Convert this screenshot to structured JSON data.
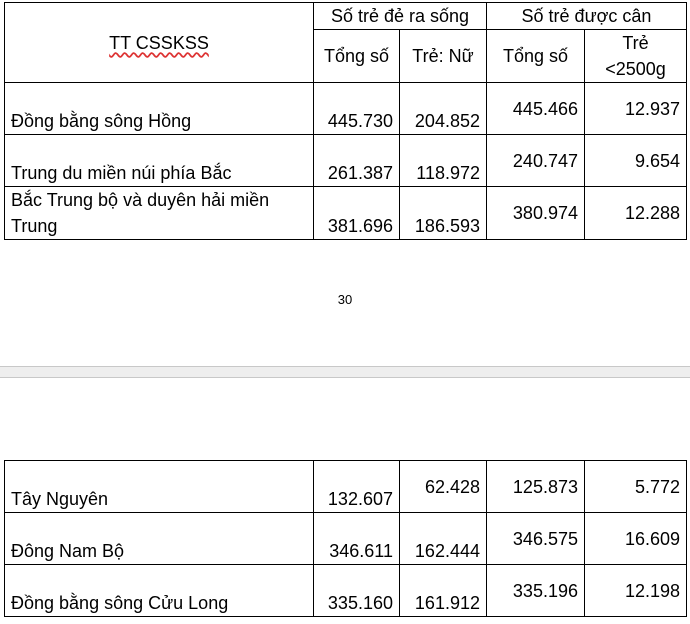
{
  "header": {
    "region_col": "TT CSSKSS",
    "group_live": "Số trẻ đẻ ra sống",
    "group_weighed": "Số trẻ được cân",
    "live_total": "Tổng số",
    "live_female": "Trẻ: Nữ",
    "weighed_total": "Tổng số",
    "weighed_low": "Trẻ <2500g"
  },
  "rows_top": [
    {
      "region": "Đồng bằng sông Hồng",
      "live_total": "445.730",
      "live_female": "204.852",
      "weighed_total": "445.466",
      "weighed_low": "12.937"
    },
    {
      "region": "Trung du miền núi phía Bắc",
      "live_total": "261.387",
      "live_female": "118.972",
      "weighed_total": "240.747",
      "weighed_low": "9.654"
    },
    {
      "region": "Bắc Trung bộ và duyên hải miền Trung",
      "live_total": "381.696",
      "live_female": "186.593",
      "weighed_total": "380.974",
      "weighed_low": "12.288"
    }
  ],
  "page_number": "30",
  "rows_bottom": [
    {
      "region": "Tây Nguyên",
      "live_total": "132.607",
      "live_female": "62.428",
      "weighed_total": "125.873",
      "weighed_low": "5.772"
    },
    {
      "region": "Đông Nam Bộ",
      "live_total": "346.611",
      "live_female": "162.444",
      "weighed_total": "346.575",
      "weighed_low": "16.609"
    },
    {
      "region": "Đồng bằng sông Cửu Long",
      "live_total": "335.160",
      "live_female": "161.912",
      "weighed_total": "335.196",
      "weighed_low": "12.198"
    }
  ]
}
